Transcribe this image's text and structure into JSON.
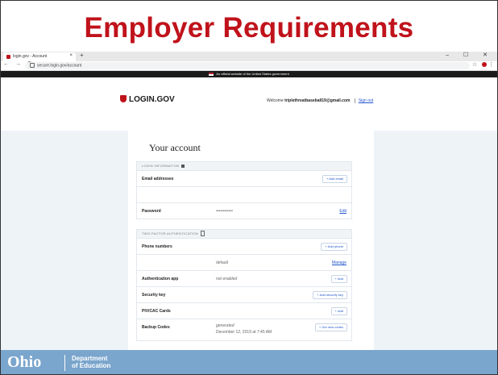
{
  "slide": {
    "title": "Employer Requirements"
  },
  "browser": {
    "tab_title": "login.gov - Account",
    "tab_close": "×",
    "new_tab": "+",
    "window_controls": "–  ☐  ✕",
    "nav_icons": "← → C",
    "url": "secure.login.gov/account",
    "toolbar_star": "☆",
    "toolbar_menu": "⋮"
  },
  "gov_banner": {
    "text": "An official website of the United States government"
  },
  "site_header": {
    "logo": "LOGIN.GOV",
    "welcome_prefix": "Welcome",
    "email": "triplethreatbaseball19@gmail.com",
    "sign_out": "Sign out"
  },
  "account": {
    "title": "Your account",
    "login_info_header": "Login Information",
    "email_label": "Email addresses",
    "add_email": "+ Add email",
    "password_label": "Password",
    "password_value": "••••••••••••",
    "password_edit": "Edit",
    "two_factor_header": "Two-Factor Authentication",
    "phone_label": "Phone numbers",
    "add_phone": "+ Add phone",
    "phone_default": "default",
    "phone_manage": "Manage",
    "auth_app_label": "Authentication app",
    "auth_app_value": "not enabled",
    "auth_app_add": "+ Add",
    "security_key_label": "Security key",
    "security_key_add": "+ Add security key",
    "piv_label": "PIV/CAC Cards",
    "piv_add": "+ Add",
    "backup_label": "Backup Codes",
    "backup_status": "generated",
    "backup_date": "December 12, 2019 at 7:45 AM",
    "backup_btn": "+ Get new codes"
  },
  "footer": {
    "ohio": "Ohio",
    "dept_line1": "Department",
    "dept_line2": "of Education"
  },
  "colors": {
    "title_red": "#c0121b",
    "footer_blue": "#7aa5cc",
    "link_blue": "#2255cc"
  }
}
